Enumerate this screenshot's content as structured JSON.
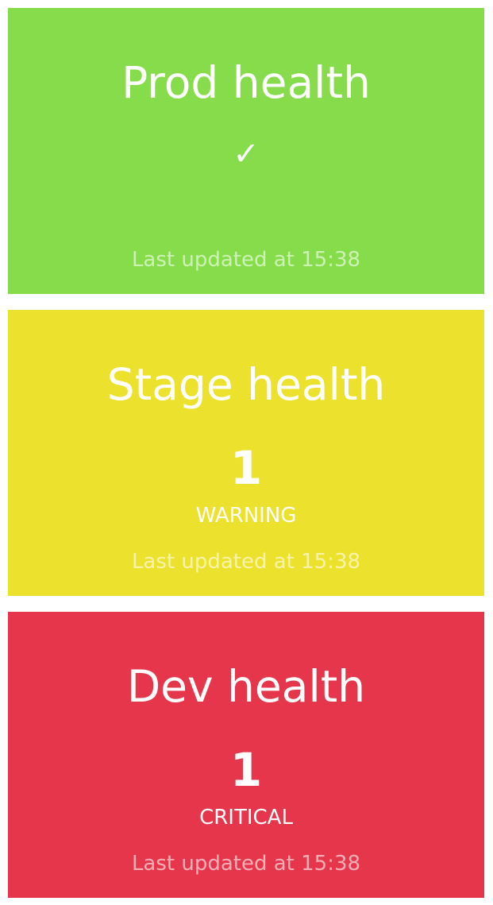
{
  "tiles": [
    {
      "title": "Prod health",
      "icon": "✓",
      "icon_name": "checkmark-icon",
      "updated": "Last updated at 15:38",
      "color": "#86dc4a"
    },
    {
      "title": "Stage health",
      "value": "1",
      "status": "WARNING",
      "updated": "Last updated at 15:38",
      "color": "#ece22e"
    },
    {
      "title": "Dev health",
      "value": "1",
      "status": "CRITICAL",
      "updated": "Last updated at 15:38",
      "color": "#e5364b"
    }
  ]
}
